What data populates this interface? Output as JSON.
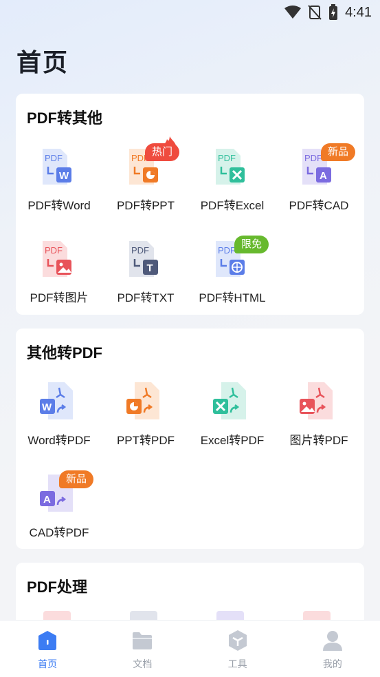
{
  "status": {
    "time": "4:41"
  },
  "page": {
    "title": "首页"
  },
  "sections": [
    {
      "title": "PDF转其他",
      "tools": [
        {
          "label": "PDF转Word",
          "badge": ""
        },
        {
          "label": "PDF转PPT",
          "badge": "热门"
        },
        {
          "label": "PDF转Excel",
          "badge": ""
        },
        {
          "label": "PDF转CAD",
          "badge": "新品"
        },
        {
          "label": "PDF转图片",
          "badge": ""
        },
        {
          "label": "PDF转TXT",
          "badge": ""
        },
        {
          "label": "PDF转HTML",
          "badge": "限免"
        }
      ]
    },
    {
      "title": "其他转PDF",
      "tools": [
        {
          "label": "Word转PDF",
          "badge": ""
        },
        {
          "label": "PPT转PDF",
          "badge": ""
        },
        {
          "label": "Excel转PDF",
          "badge": ""
        },
        {
          "label": "图片转PDF",
          "badge": ""
        },
        {
          "label": "CAD转PDF",
          "badge": "新品"
        }
      ]
    },
    {
      "title": "PDF处理"
    }
  ],
  "tabs": [
    {
      "label": "首页",
      "icon": "home-icon",
      "active": true
    },
    {
      "label": "文档",
      "icon": "folder-icon",
      "active": false
    },
    {
      "label": "工具",
      "icon": "toolbox-icon",
      "active": false
    },
    {
      "label": "我的",
      "icon": "user-icon",
      "active": false
    }
  ],
  "colors": {
    "accent": "#3c7cf3",
    "word": "#5b7de8",
    "ppt": "#f07a26",
    "excel": "#2fbf9b",
    "cad": "#7b6be0",
    "image": "#e8535a",
    "txt": "#4f5a7a"
  }
}
